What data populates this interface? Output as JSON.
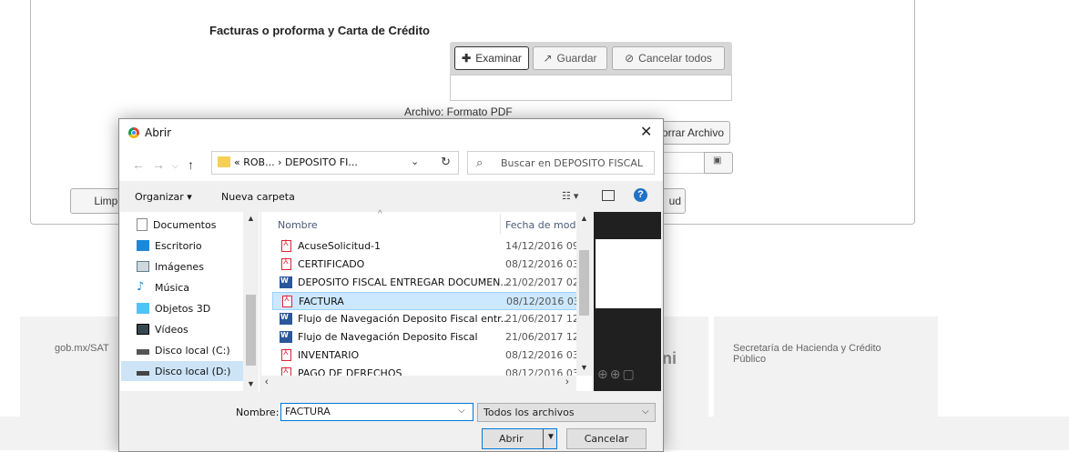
{
  "page": {
    "section_title": "Facturas o proforma y Carta de Crédito",
    "buttons": {
      "examinar": "Examinar",
      "guardar": "Guardar",
      "cancelar_todos": "Cancelar todos",
      "borrar_archivo": "orrar Archivo",
      "limpiar": "Limpi",
      "solicitud": "ud"
    },
    "archivo_label": "Archivo: Formato PDF",
    "footer": {
      "left_text": "gob.mx/SAT",
      "logo_text": "ni",
      "right_text": "Secretaría de Hacienda y Crédito Público"
    }
  },
  "dialog": {
    "title": "Abrir",
    "address": "«  ROB...  ›  DEPOSITO FI...",
    "search_placeholder": "Buscar en DEPOSITO FISCAL",
    "organizar": "Organizar ▾",
    "nueva_carpeta": "Nueva carpeta",
    "nav_items": [
      {
        "label": "Documentos",
        "icon": "documents-icon"
      },
      {
        "label": "Escritorio",
        "icon": "desktop-icon"
      },
      {
        "label": "Imágenes",
        "icon": "pictures-icon"
      },
      {
        "label": "Música",
        "icon": "music-icon"
      },
      {
        "label": "Objetos 3D",
        "icon": "objects-3d-icon"
      },
      {
        "label": "Vídeos",
        "icon": "videos-icon"
      },
      {
        "label": "Disco local (C:)",
        "icon": "drive-icon"
      },
      {
        "label": "Disco local (D:)",
        "icon": "drive-icon",
        "selected": true
      }
    ],
    "columns": {
      "name": "Nombre",
      "date": "Fecha de mod"
    },
    "files": [
      {
        "name": "AcuseSolicitud-1",
        "date": "14/12/2016 09:",
        "type": "pdf"
      },
      {
        "name": "CERTIFICADO",
        "date": "08/12/2016 03:",
        "type": "pdf"
      },
      {
        "name": "DEPOSITO FISCAL ENTREGAR DOCUMEN...",
        "date": "21/02/2017 02:",
        "type": "word"
      },
      {
        "name": "FACTURA",
        "date": "08/12/2016 03:",
        "type": "pdf",
        "selected": true
      },
      {
        "name": "Flujo de Navegación Deposito Fiscal entr...",
        "date": "21/06/2017 12:",
        "type": "word"
      },
      {
        "name": "Flujo de Navegación Deposito Fiscal",
        "date": "21/06/2017 12:",
        "type": "word"
      },
      {
        "name": "INVENTARIO",
        "date": "08/12/2016 03:",
        "type": "pdf"
      },
      {
        "name": "PAGO DE DERECHOS",
        "date": "08/12/2016 03:",
        "type": "pdf"
      }
    ],
    "name_label": "Nombre:",
    "name_value": "FACTURA",
    "file_type": "Todos los archivos",
    "abrir_label": "Abrir",
    "cancelar_label": "Cancelar"
  },
  "colors": {
    "accent": "#0078d7",
    "selection": "#cce8ff",
    "help": "#1f72c7"
  }
}
